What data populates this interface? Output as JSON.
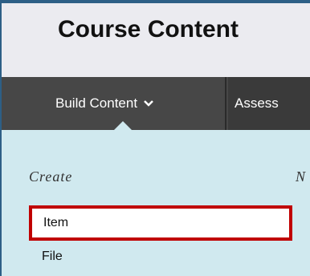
{
  "page": {
    "title": "Course Content"
  },
  "toolbar": {
    "build_content": "Build Content",
    "assess": "Assess"
  },
  "menu": {
    "create_label": "Create",
    "second_label_partial": "N",
    "items": [
      "Item",
      "File"
    ]
  },
  "colors": {
    "highlight_border": "#c00000",
    "panel_bg": "#d0e9ef",
    "toolbar_bg": "#3a3a3a",
    "frame_blue": "#2d5f86"
  }
}
